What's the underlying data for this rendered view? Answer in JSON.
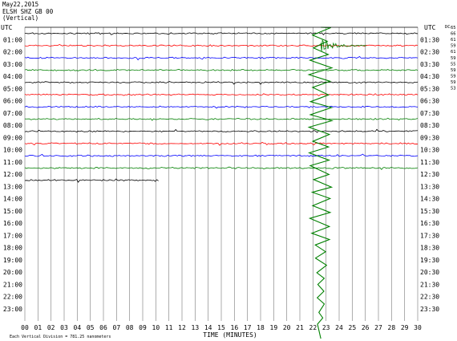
{
  "header": {
    "date": "May22,2015",
    "station": "ELSH SHZ GB 00",
    "component": "(Vertical)"
  },
  "chart_data": {
    "type": "line",
    "title": "May22,2015",
    "subtitle": "ELSH SHZ GB 00 (Vertical)",
    "xlabel": "TIME (MINUTES)",
    "x_ticks": [
      "00",
      "01",
      "02",
      "03",
      "04",
      "05",
      "06",
      "07",
      "08",
      "09",
      "10",
      "11",
      "12",
      "13",
      "14",
      "15",
      "16",
      "17",
      "18",
      "19",
      "20",
      "21",
      "22",
      "23",
      "24",
      "25",
      "26",
      "27",
      "28",
      "29",
      "30"
    ],
    "xlim": [
      0,
      30
    ],
    "left_axis_label": "UTC",
    "right_axis_label": "UTC",
    "left_ticks": [
      "01:00",
      "02:00",
      "03:00",
      "04:00",
      "05:00",
      "06:00",
      "07:00",
      "08:00",
      "09:00",
      "10:00",
      "11:00",
      "12:00",
      "13:00",
      "14:00",
      "15:00",
      "16:00",
      "17:00",
      "18:00",
      "19:00",
      "20:00",
      "21:00",
      "22:00",
      "23:00"
    ],
    "right_ticks": [
      "01:30",
      "02:30",
      "03:30",
      "04:30",
      "05:30",
      "06:30",
      "07:30",
      "08:30",
      "09:30",
      "10:30",
      "11:30",
      "12:30",
      "13:30",
      "14:30",
      "15:30",
      "16:30",
      "17:30",
      "18:30",
      "19:30",
      "20:30",
      "21:30",
      "22:30",
      "23:30"
    ],
    "right_corner_label": "DC",
    "dc_offsets": [
      "65",
      "66",
      "61",
      "59",
      "61",
      "59",
      "55",
      "59",
      "59",
      "59",
      "53"
    ],
    "footer_note": "Each Vertical Division = 781.25 nanometers",
    "series_colors": [
      "#000000",
      "#ff0000",
      "#0000ff",
      "#008000"
    ],
    "traces_drawn": 13,
    "last_trace_end_minute": 10.2,
    "event": {
      "minute": 22.6,
      "color": "#008000"
    },
    "grid": true
  }
}
